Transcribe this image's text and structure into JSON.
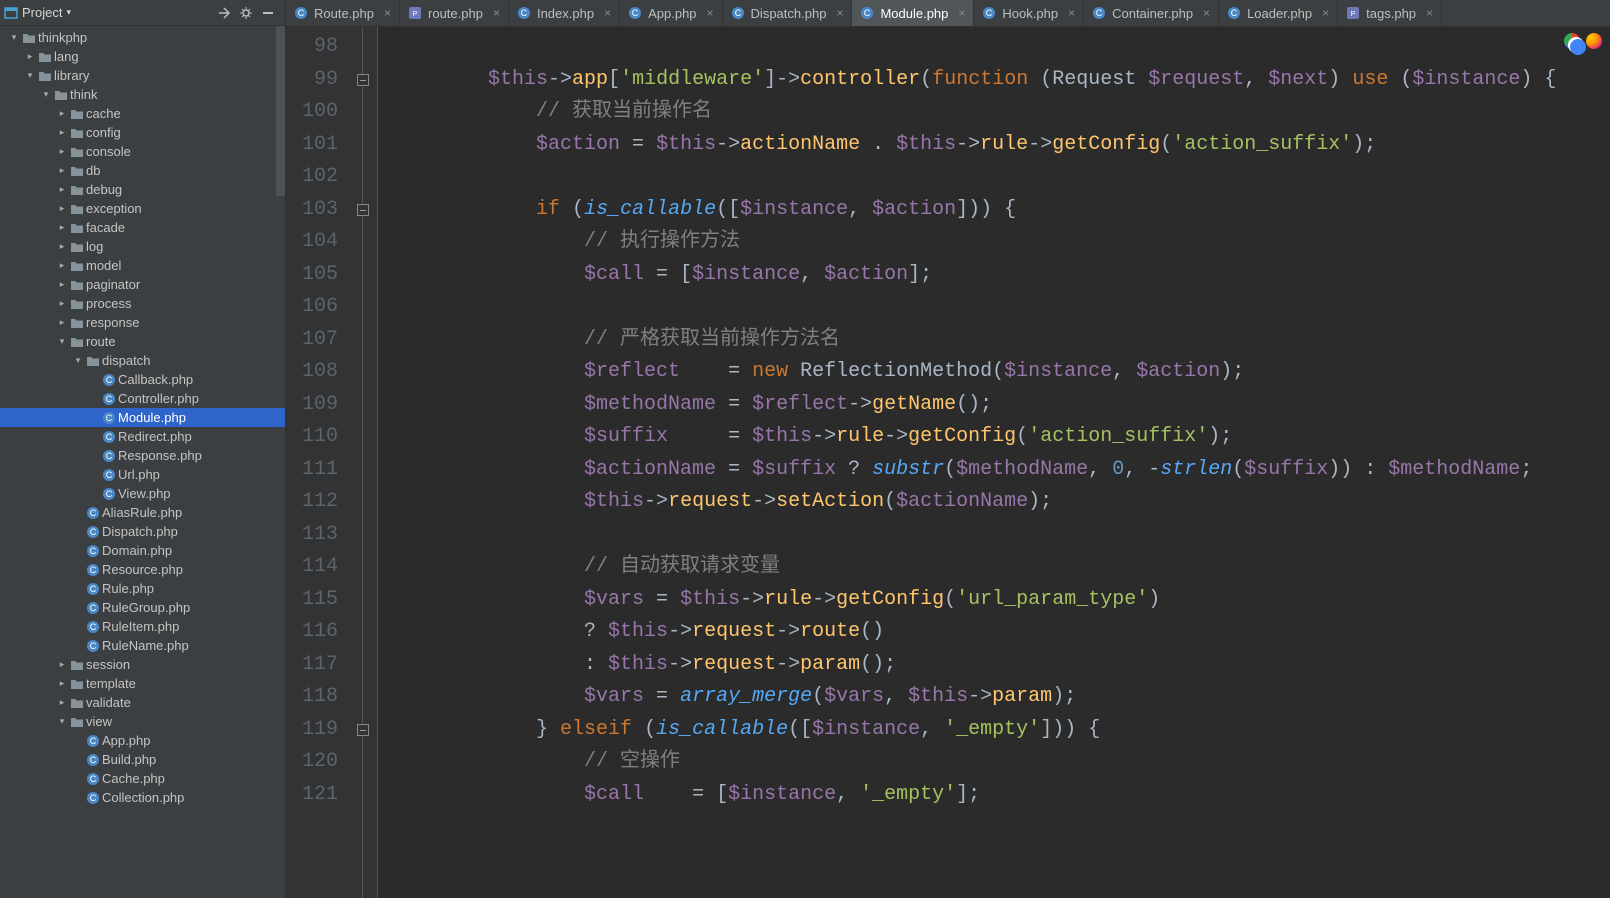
{
  "toolbar": {
    "project_label": "Project"
  },
  "tree": [
    {
      "depth": 0,
      "arrow": "down",
      "icon": "folder",
      "label": "thinkphp"
    },
    {
      "depth": 1,
      "arrow": "right",
      "icon": "folder",
      "label": "lang"
    },
    {
      "depth": 1,
      "arrow": "down",
      "icon": "folder",
      "label": "library"
    },
    {
      "depth": 2,
      "arrow": "down",
      "icon": "folder",
      "label": "think"
    },
    {
      "depth": 3,
      "arrow": "right",
      "icon": "folder",
      "label": "cache"
    },
    {
      "depth": 3,
      "arrow": "right",
      "icon": "folder",
      "label": "config"
    },
    {
      "depth": 3,
      "arrow": "right",
      "icon": "folder",
      "label": "console"
    },
    {
      "depth": 3,
      "arrow": "right",
      "icon": "folder",
      "label": "db"
    },
    {
      "depth": 3,
      "arrow": "right",
      "icon": "folder",
      "label": "debug"
    },
    {
      "depth": 3,
      "arrow": "right",
      "icon": "folder",
      "label": "exception"
    },
    {
      "depth": 3,
      "arrow": "right",
      "icon": "folder",
      "label": "facade"
    },
    {
      "depth": 3,
      "arrow": "right",
      "icon": "folder",
      "label": "log"
    },
    {
      "depth": 3,
      "arrow": "right",
      "icon": "folder",
      "label": "model"
    },
    {
      "depth": 3,
      "arrow": "right",
      "icon": "folder",
      "label": "paginator"
    },
    {
      "depth": 3,
      "arrow": "right",
      "icon": "folder",
      "label": "process"
    },
    {
      "depth": 3,
      "arrow": "right",
      "icon": "folder",
      "label": "response"
    },
    {
      "depth": 3,
      "arrow": "down",
      "icon": "folder",
      "label": "route"
    },
    {
      "depth": 4,
      "arrow": "down",
      "icon": "folder",
      "label": "dispatch"
    },
    {
      "depth": 5,
      "arrow": "",
      "icon": "class",
      "label": "Callback.php"
    },
    {
      "depth": 5,
      "arrow": "",
      "icon": "class",
      "label": "Controller.php"
    },
    {
      "depth": 5,
      "arrow": "",
      "icon": "class",
      "label": "Module.php",
      "selected": true
    },
    {
      "depth": 5,
      "arrow": "",
      "icon": "class",
      "label": "Redirect.php"
    },
    {
      "depth": 5,
      "arrow": "",
      "icon": "class",
      "label": "Response.php"
    },
    {
      "depth": 5,
      "arrow": "",
      "icon": "class",
      "label": "Url.php"
    },
    {
      "depth": 5,
      "arrow": "",
      "icon": "class",
      "label": "View.php"
    },
    {
      "depth": 4,
      "arrow": "",
      "icon": "class",
      "label": "AliasRule.php"
    },
    {
      "depth": 4,
      "arrow": "",
      "icon": "class",
      "label": "Dispatch.php"
    },
    {
      "depth": 4,
      "arrow": "",
      "icon": "class",
      "label": "Domain.php"
    },
    {
      "depth": 4,
      "arrow": "",
      "icon": "class",
      "label": "Resource.php"
    },
    {
      "depth": 4,
      "arrow": "",
      "icon": "class",
      "label": "Rule.php"
    },
    {
      "depth": 4,
      "arrow": "",
      "icon": "class",
      "label": "RuleGroup.php"
    },
    {
      "depth": 4,
      "arrow": "",
      "icon": "class",
      "label": "RuleItem.php"
    },
    {
      "depth": 4,
      "arrow": "",
      "icon": "class",
      "label": "RuleName.php"
    },
    {
      "depth": 3,
      "arrow": "right",
      "icon": "folder",
      "label": "session"
    },
    {
      "depth": 3,
      "arrow": "right",
      "icon": "folder",
      "label": "template"
    },
    {
      "depth": 3,
      "arrow": "right",
      "icon": "folder",
      "label": "validate"
    },
    {
      "depth": 3,
      "arrow": "down",
      "icon": "folder",
      "label": "view"
    },
    {
      "depth": 4,
      "arrow": "",
      "icon": "class",
      "label": "App.php"
    },
    {
      "depth": 4,
      "arrow": "",
      "icon": "class",
      "label": "Build.php"
    },
    {
      "depth": 4,
      "arrow": "",
      "icon": "class",
      "label": "Cache.php"
    },
    {
      "depth": 4,
      "arrow": "",
      "icon": "class",
      "label": "Collection.php"
    }
  ],
  "tabs": [
    {
      "icon": "class",
      "label": "Route.php"
    },
    {
      "icon": "php",
      "label": "route.php"
    },
    {
      "icon": "class",
      "label": "Index.php"
    },
    {
      "icon": "class",
      "label": "App.php"
    },
    {
      "icon": "class",
      "label": "Dispatch.php"
    },
    {
      "icon": "class",
      "label": "Module.php",
      "active": true
    },
    {
      "icon": "class",
      "label": "Hook.php"
    },
    {
      "icon": "class",
      "label": "Container.php"
    },
    {
      "icon": "class",
      "label": "Loader.php"
    },
    {
      "icon": "php",
      "label": "tags.php"
    }
  ],
  "lines": {
    "start": 98,
    "end": 121,
    "fold_markers_at": [
      99,
      103,
      119
    ]
  },
  "code_lines": [
    [],
    [
      {
        "t": "        ",
        "c": "punct"
      },
      {
        "t": "$this",
        "c": "var"
      },
      {
        "t": "->",
        "c": "arrow"
      },
      {
        "t": "app",
        "c": "call"
      },
      {
        "t": "[",
        "c": "punct"
      },
      {
        "t": "'middleware'",
        "c": "string"
      },
      {
        "t": "]",
        "c": "punct"
      },
      {
        "t": "->",
        "c": "arrow"
      },
      {
        "t": "controller",
        "c": "call"
      },
      {
        "t": "(",
        "c": "paren"
      },
      {
        "t": "function ",
        "c": "kw"
      },
      {
        "t": "(",
        "c": "paren"
      },
      {
        "t": "Request ",
        "c": "type"
      },
      {
        "t": "$request",
        "c": "var"
      },
      {
        "t": ", ",
        "c": "punct"
      },
      {
        "t": "$next",
        "c": "var"
      },
      {
        "t": ") ",
        "c": "paren"
      },
      {
        "t": "use ",
        "c": "kw"
      },
      {
        "t": "(",
        "c": "paren"
      },
      {
        "t": "$instance",
        "c": "var"
      },
      {
        "t": ") {",
        "c": "paren"
      }
    ],
    [
      {
        "t": "            ",
        "c": "punct"
      },
      {
        "t": "// 获取当前操作名",
        "c": "comment"
      }
    ],
    [
      {
        "t": "            ",
        "c": "punct"
      },
      {
        "t": "$action",
        "c": "var"
      },
      {
        "t": " = ",
        "c": "punct"
      },
      {
        "t": "$this",
        "c": "var"
      },
      {
        "t": "->",
        "c": "arrow"
      },
      {
        "t": "actionName",
        "c": "call"
      },
      {
        "t": " . ",
        "c": "punct"
      },
      {
        "t": "$this",
        "c": "var"
      },
      {
        "t": "->",
        "c": "arrow"
      },
      {
        "t": "rule",
        "c": "call"
      },
      {
        "t": "->",
        "c": "arrow"
      },
      {
        "t": "getConfig",
        "c": "call"
      },
      {
        "t": "(",
        "c": "paren"
      },
      {
        "t": "'action_suffix'",
        "c": "string"
      },
      {
        "t": ");",
        "c": "punct"
      }
    ],
    [],
    [
      {
        "t": "            ",
        "c": "punct"
      },
      {
        "t": "if ",
        "c": "kw"
      },
      {
        "t": "(",
        "c": "paren"
      },
      {
        "t": "is_callable",
        "c": "func"
      },
      {
        "t": "([",
        "c": "paren"
      },
      {
        "t": "$instance",
        "c": "var"
      },
      {
        "t": ", ",
        "c": "punct"
      },
      {
        "t": "$action",
        "c": "var"
      },
      {
        "t": "])) {",
        "c": "paren"
      }
    ],
    [
      {
        "t": "                ",
        "c": "punct"
      },
      {
        "t": "// 执行操作方法",
        "c": "comment"
      }
    ],
    [
      {
        "t": "                ",
        "c": "punct"
      },
      {
        "t": "$call",
        "c": "var"
      },
      {
        "t": " = [",
        "c": "punct"
      },
      {
        "t": "$instance",
        "c": "var"
      },
      {
        "t": ", ",
        "c": "punct"
      },
      {
        "t": "$action",
        "c": "var"
      },
      {
        "t": "];",
        "c": "punct"
      }
    ],
    [],
    [
      {
        "t": "                ",
        "c": "punct"
      },
      {
        "t": "// 严格获取当前操作方法名",
        "c": "comment"
      }
    ],
    [
      {
        "t": "                ",
        "c": "punct"
      },
      {
        "t": "$reflect    ",
        "c": "var"
      },
      {
        "t": "= ",
        "c": "punct"
      },
      {
        "t": "new ",
        "c": "kw"
      },
      {
        "t": "ReflectionMethod(",
        "c": "type"
      },
      {
        "t": "$instance",
        "c": "var"
      },
      {
        "t": ", ",
        "c": "punct"
      },
      {
        "t": "$action",
        "c": "var"
      },
      {
        "t": ");",
        "c": "punct"
      }
    ],
    [
      {
        "t": "                ",
        "c": "punct"
      },
      {
        "t": "$methodName",
        "c": "var"
      },
      {
        "t": " = ",
        "c": "punct"
      },
      {
        "t": "$reflect",
        "c": "var"
      },
      {
        "t": "->",
        "c": "arrow"
      },
      {
        "t": "getName",
        "c": "call"
      },
      {
        "t": "();",
        "c": "punct"
      }
    ],
    [
      {
        "t": "                ",
        "c": "punct"
      },
      {
        "t": "$suffix     ",
        "c": "var"
      },
      {
        "t": "= ",
        "c": "punct"
      },
      {
        "t": "$this",
        "c": "var"
      },
      {
        "t": "->",
        "c": "arrow"
      },
      {
        "t": "rule",
        "c": "call"
      },
      {
        "t": "->",
        "c": "arrow"
      },
      {
        "t": "getConfig",
        "c": "call"
      },
      {
        "t": "(",
        "c": "paren"
      },
      {
        "t": "'action_suffix'",
        "c": "string"
      },
      {
        "t": ");",
        "c": "punct"
      }
    ],
    [
      {
        "t": "                ",
        "c": "punct"
      },
      {
        "t": "$actionName",
        "c": "var"
      },
      {
        "t": " = ",
        "c": "punct"
      },
      {
        "t": "$suffix",
        "c": "var"
      },
      {
        "t": " ? ",
        "c": "punct"
      },
      {
        "t": "substr",
        "c": "func"
      },
      {
        "t": "(",
        "c": "paren"
      },
      {
        "t": "$methodName",
        "c": "var"
      },
      {
        "t": ", ",
        "c": "punct"
      },
      {
        "t": "0",
        "c": "num"
      },
      {
        "t": ", -",
        "c": "punct"
      },
      {
        "t": "strlen",
        "c": "func"
      },
      {
        "t": "(",
        "c": "paren"
      },
      {
        "t": "$suffix",
        "c": "var"
      },
      {
        "t": ")) : ",
        "c": "punct"
      },
      {
        "t": "$methodName",
        "c": "var"
      },
      {
        "t": ";",
        "c": "punct"
      }
    ],
    [
      {
        "t": "                ",
        "c": "punct"
      },
      {
        "t": "$this",
        "c": "var"
      },
      {
        "t": "->",
        "c": "arrow"
      },
      {
        "t": "request",
        "c": "call"
      },
      {
        "t": "->",
        "c": "arrow"
      },
      {
        "t": "setAction",
        "c": "call"
      },
      {
        "t": "(",
        "c": "paren"
      },
      {
        "t": "$actionName",
        "c": "var"
      },
      {
        "t": ");",
        "c": "punct"
      }
    ],
    [],
    [
      {
        "t": "                ",
        "c": "punct"
      },
      {
        "t": "// 自动获取请求变量",
        "c": "comment"
      }
    ],
    [
      {
        "t": "                ",
        "c": "punct"
      },
      {
        "t": "$vars",
        "c": "var"
      },
      {
        "t": " = ",
        "c": "punct"
      },
      {
        "t": "$this",
        "c": "var"
      },
      {
        "t": "->",
        "c": "arrow"
      },
      {
        "t": "rule",
        "c": "call"
      },
      {
        "t": "->",
        "c": "arrow"
      },
      {
        "t": "getConfig",
        "c": "call"
      },
      {
        "t": "(",
        "c": "paren"
      },
      {
        "t": "'url_param_type'",
        "c": "string"
      },
      {
        "t": ")",
        "c": "paren"
      }
    ],
    [
      {
        "t": "                ",
        "c": "punct"
      },
      {
        "t": "? ",
        "c": "punct"
      },
      {
        "t": "$this",
        "c": "var"
      },
      {
        "t": "->",
        "c": "arrow"
      },
      {
        "t": "request",
        "c": "call"
      },
      {
        "t": "->",
        "c": "arrow"
      },
      {
        "t": "route",
        "c": "call"
      },
      {
        "t": "()",
        "c": "paren"
      }
    ],
    [
      {
        "t": "                ",
        "c": "punct"
      },
      {
        "t": ": ",
        "c": "punct"
      },
      {
        "t": "$this",
        "c": "var"
      },
      {
        "t": "->",
        "c": "arrow"
      },
      {
        "t": "request",
        "c": "call"
      },
      {
        "t": "->",
        "c": "arrow"
      },
      {
        "t": "param",
        "c": "call"
      },
      {
        "t": "();",
        "c": "punct"
      }
    ],
    [
      {
        "t": "                ",
        "c": "punct"
      },
      {
        "t": "$vars",
        "c": "var"
      },
      {
        "t": " = ",
        "c": "punct"
      },
      {
        "t": "array_merge",
        "c": "func"
      },
      {
        "t": "(",
        "c": "paren"
      },
      {
        "t": "$vars",
        "c": "var"
      },
      {
        "t": ", ",
        "c": "punct"
      },
      {
        "t": "$this",
        "c": "var"
      },
      {
        "t": "->",
        "c": "arrow"
      },
      {
        "t": "param",
        "c": "call"
      },
      {
        "t": ");",
        "c": "punct"
      }
    ],
    [
      {
        "t": "            ",
        "c": "punct"
      },
      {
        "t": "} ",
        "c": "paren"
      },
      {
        "t": "elseif ",
        "c": "kw"
      },
      {
        "t": "(",
        "c": "paren"
      },
      {
        "t": "is_callable",
        "c": "func"
      },
      {
        "t": "([",
        "c": "paren"
      },
      {
        "t": "$instance",
        "c": "var"
      },
      {
        "t": ", ",
        "c": "punct"
      },
      {
        "t": "'_empty'",
        "c": "string"
      },
      {
        "t": "])) {",
        "c": "paren"
      }
    ],
    [
      {
        "t": "                ",
        "c": "punct"
      },
      {
        "t": "// 空操作",
        "c": "comment"
      }
    ],
    [
      {
        "t": "                ",
        "c": "punct"
      },
      {
        "t": "$call    ",
        "c": "var"
      },
      {
        "t": "= [",
        "c": "punct"
      },
      {
        "t": "$instance",
        "c": "var"
      },
      {
        "t": ", ",
        "c": "punct"
      },
      {
        "t": "'_empty'",
        "c": "string"
      },
      {
        "t": "];",
        "c": "punct"
      }
    ]
  ]
}
